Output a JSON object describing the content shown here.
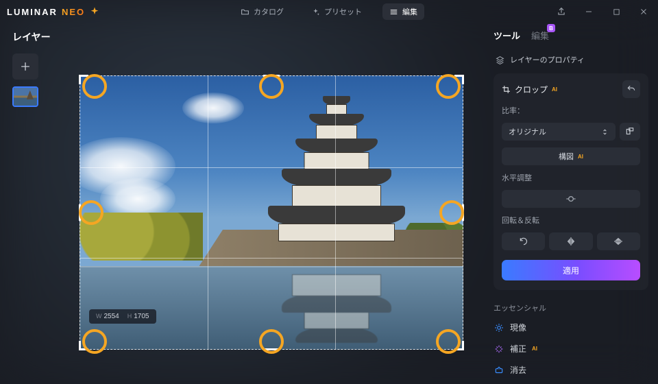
{
  "app": {
    "logo_l": "LUMINAR",
    "logo_r": "NEO"
  },
  "topnav": {
    "catalog": "カタログ",
    "presets": "プリセット",
    "edit": "編集"
  },
  "layers": {
    "title": "レイヤー"
  },
  "canvas": {
    "w_label": "W",
    "w_val": "2554",
    "h_label": "H",
    "h_val": "1705"
  },
  "rpanel": {
    "tab_tools": "ツール",
    "tab_edits": "編集",
    "badge": "B",
    "layer_props": "レイヤーのプロパティ",
    "crop_title": "クロップ",
    "ratio_label": "比率：",
    "ratio_value": "オリジナル",
    "composition_btn": "構図",
    "horizon_label": "水平調整",
    "rotflip_label": "回転＆反転",
    "apply": "適用",
    "essentials_title": "エッセンシャル",
    "ess_develop": "現像",
    "ess_enhance": "補正",
    "ess_erase": "消去",
    "ai": "AI"
  }
}
